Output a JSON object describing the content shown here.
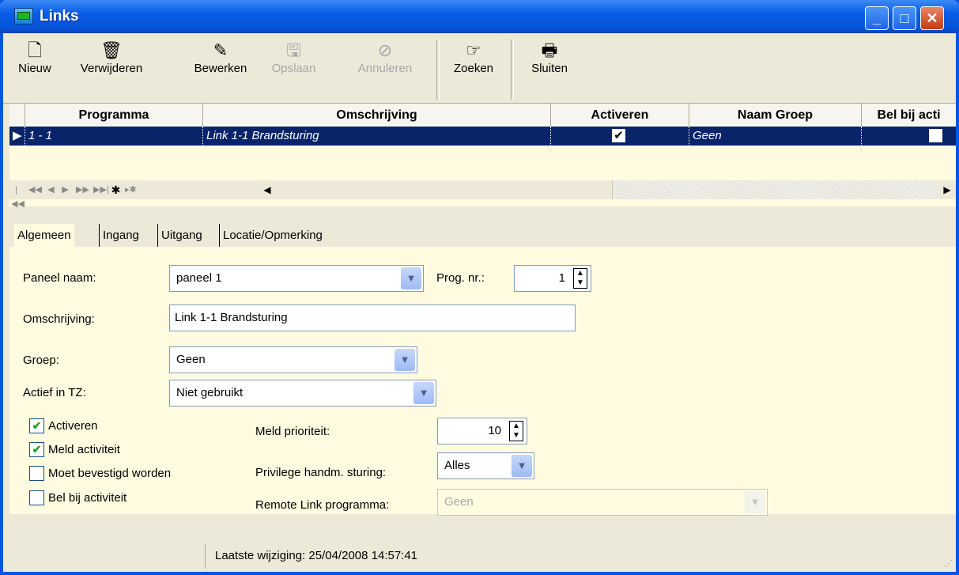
{
  "window": {
    "title": "Links"
  },
  "toolbar": {
    "nieuw": "Nieuw",
    "verwijderen": "Verwijderen",
    "bewerken": "Bewerken",
    "opslaan": "Opslaan",
    "annuleren": "Annuleren",
    "zoeken": "Zoeken",
    "sluiten": "Sluiten"
  },
  "grid": {
    "columns": [
      "Programma",
      "Omschrijving",
      "Activeren",
      "Naam Groep",
      "Bel bij acti"
    ],
    "rows": [
      {
        "programma": "1 - 1",
        "omschrijving": "Link 1-1 Brandsturing",
        "activeren": true,
        "naam_groep": "Geen",
        "bel": false
      }
    ]
  },
  "tabs": [
    "Algemeen",
    "Ingang",
    "Uitgang",
    "Locatie/Opmerking"
  ],
  "form": {
    "paneel_naam_label": "Paneel naam:",
    "paneel_naam_value": "paneel 1",
    "prog_nr_label": "Prog. nr.:",
    "prog_nr_value": "1",
    "omschrijving_label": "Omschrijving:",
    "omschrijving_value": "Link 1-1 Brandsturing",
    "groep_label": "Groep:",
    "groep_value": "Geen",
    "actief_label": "Actief in TZ:",
    "actief_value": "Niet gebruikt",
    "chk_activeren": "Activeren",
    "chk_meld": "Meld activiteit",
    "chk_bevestigd": "Moet bevestigd worden",
    "chk_bel": "Bel bij activiteit",
    "meld_prio_label": "Meld prioriteit:",
    "meld_prio_value": "10",
    "privilege_label": "Privilege handm. sturing:",
    "privilege_value": "Alles",
    "remote_label": "Remote Link programma:",
    "remote_value": "Geen"
  },
  "status": {
    "text": "Laatste wijziging: 25/04/2008 14:57:41"
  },
  "colors": {
    "title_bar": "#0a5ce6",
    "selection": "#0a246a",
    "panel_bg": "#fffbe0"
  }
}
